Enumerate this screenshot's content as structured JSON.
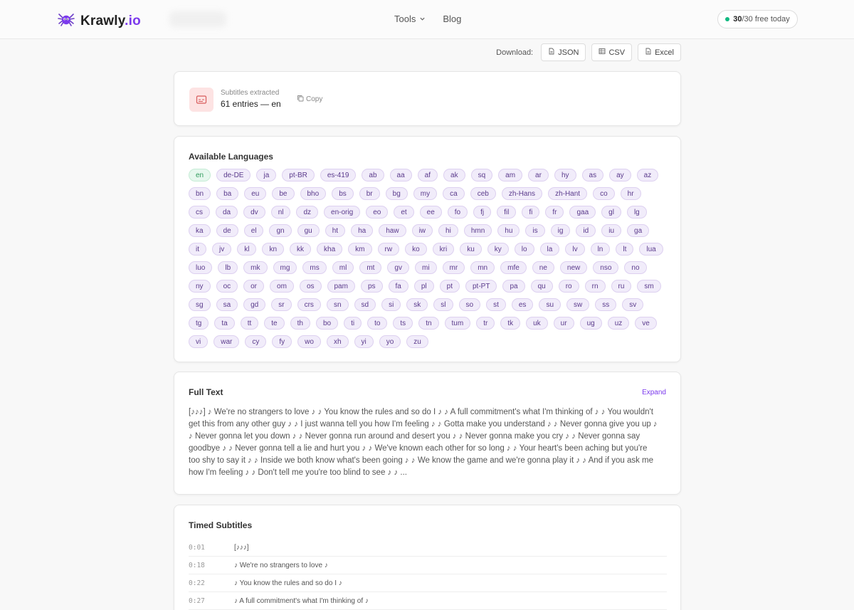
{
  "header": {
    "logo_prefix": "Krawly",
    "logo_suffix": ".io",
    "nav": [
      {
        "label": "Tools",
        "has_dropdown": true
      },
      {
        "label": "Blog",
        "has_dropdown": false
      }
    ],
    "quota_used": "30",
    "quota_rest": "/30 free today"
  },
  "download": {
    "label": "Download:",
    "buttons": [
      "JSON",
      "CSV",
      "Excel"
    ]
  },
  "summary": {
    "label": "Subtitles extracted",
    "value": "61 entries — en",
    "copy_label": "Copy"
  },
  "languages": {
    "title": "Available Languages",
    "active": "en",
    "list": [
      "en",
      "de-DE",
      "ja",
      "pt-BR",
      "es-419",
      "ab",
      "aa",
      "af",
      "ak",
      "sq",
      "am",
      "ar",
      "hy",
      "as",
      "ay",
      "az",
      "bn",
      "ba",
      "eu",
      "be",
      "bho",
      "bs",
      "br",
      "bg",
      "my",
      "ca",
      "ceb",
      "zh-Hans",
      "zh-Hant",
      "co",
      "hr",
      "cs",
      "da",
      "dv",
      "nl",
      "dz",
      "en-orig",
      "eo",
      "et",
      "ee",
      "fo",
      "fj",
      "fil",
      "fi",
      "fr",
      "gaa",
      "gl",
      "lg",
      "ka",
      "de",
      "el",
      "gn",
      "gu",
      "ht",
      "ha",
      "haw",
      "iw",
      "hi",
      "hmn",
      "hu",
      "is",
      "ig",
      "id",
      "iu",
      "ga",
      "it",
      "jv",
      "kl",
      "kn",
      "kk",
      "kha",
      "km",
      "rw",
      "ko",
      "kri",
      "ku",
      "ky",
      "lo",
      "la",
      "lv",
      "ln",
      "lt",
      "lua",
      "luo",
      "lb",
      "mk",
      "mg",
      "ms",
      "ml",
      "mt",
      "gv",
      "mi",
      "mr",
      "mn",
      "mfe",
      "ne",
      "new",
      "nso",
      "no",
      "ny",
      "oc",
      "or",
      "om",
      "os",
      "pam",
      "ps",
      "fa",
      "pl",
      "pt",
      "pt-PT",
      "pa",
      "qu",
      "ro",
      "rn",
      "ru",
      "sm",
      "sg",
      "sa",
      "gd",
      "sr",
      "crs",
      "sn",
      "sd",
      "si",
      "sk",
      "sl",
      "so",
      "st",
      "es",
      "su",
      "sw",
      "ss",
      "sv",
      "tg",
      "ta",
      "tt",
      "te",
      "th",
      "bo",
      "ti",
      "to",
      "ts",
      "tn",
      "tum",
      "tr",
      "tk",
      "uk",
      "ur",
      "ug",
      "uz",
      "ve",
      "vi",
      "war",
      "cy",
      "fy",
      "wo",
      "xh",
      "yi",
      "yo",
      "zu"
    ]
  },
  "full_text": {
    "title": "Full Text",
    "expand_label": "Expand",
    "body": "[♪♪♪] ♪ We're no strangers to love ♪ ♪ You know the rules and so do I ♪ ♪ A full commitment's what I'm thinking of ♪ ♪ You wouldn't get this from any other guy ♪ ♪ I just wanna tell you how I'm feeling ♪ ♪ Gotta make you understand ♪ ♪ Never gonna give you up ♪ ♪ Never gonna let you down ♪ ♪ Never gonna run around and desert you ♪ ♪ Never gonna make you cry ♪ ♪ Never gonna say goodbye ♪ ♪ Never gonna tell a lie and hurt you ♪ ♪ We've known each other for so long ♪ ♪ Your heart's been aching but you're too shy to say it ♪ ♪ Inside we both know what's been going ♪ ♪ We know the game and we're gonna play it ♪ ♪ And if you ask me how I'm feeling ♪ ♪ Don't tell me you're too blind to see ♪ ♪ ..."
  },
  "timed": {
    "title": "Timed Subtitles",
    "rows": [
      {
        "time": "0:01",
        "text": "[♪♪♪]"
      },
      {
        "time": "0:18",
        "text": "♪ We're no strangers to love ♪"
      },
      {
        "time": "0:22",
        "text": "♪ You know the rules and so do I ♪"
      },
      {
        "time": "0:27",
        "text": "♪ A full commitment's what I'm thinking of ♪"
      }
    ]
  },
  "colors": {
    "accent": "#7c3aed",
    "active_chip": "#2f9a5c",
    "status_dot": "#10b981"
  }
}
